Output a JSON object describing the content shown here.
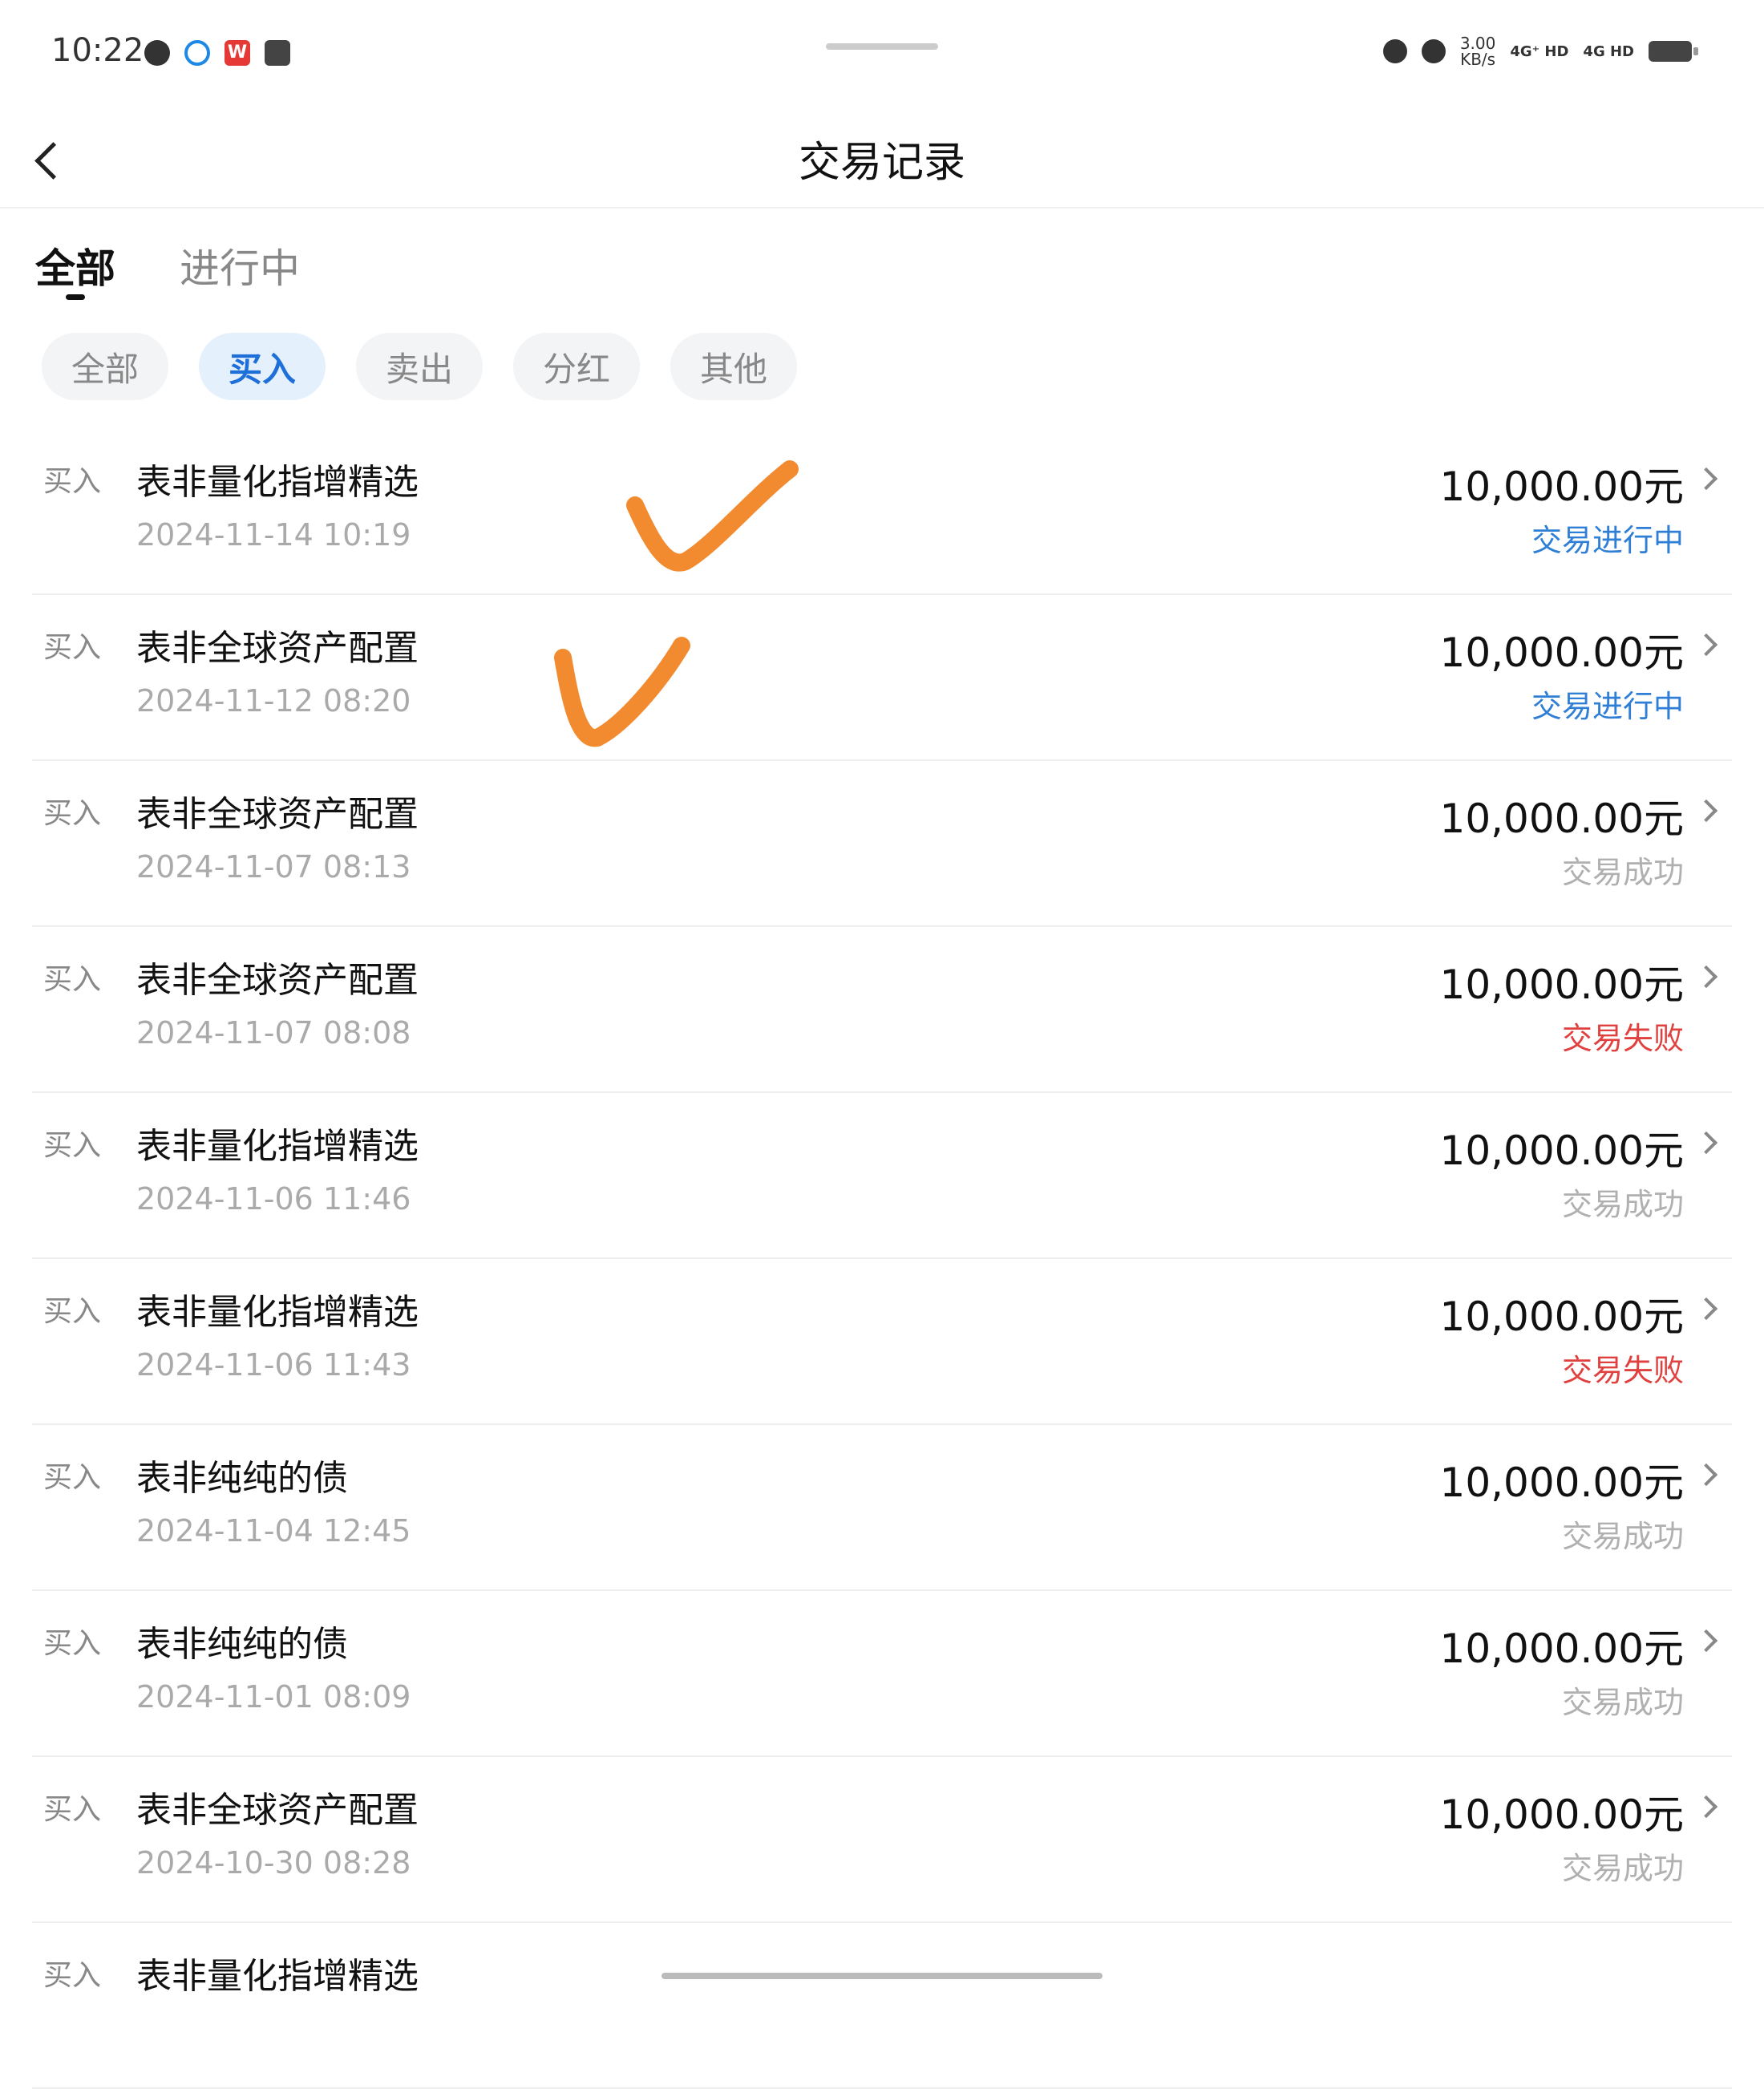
{
  "status_bar": {
    "time": "10:22",
    "speed_value": "3.00",
    "speed_unit": "KB/s",
    "net1": "4G⁺ HD",
    "net2": "4G HD"
  },
  "header": {
    "title": "交易记录"
  },
  "tabs": [
    {
      "label": "全部",
      "active": true
    },
    {
      "label": "进行中",
      "active": false
    }
  ],
  "filters": [
    {
      "label": "全部",
      "active": false
    },
    {
      "label": "买入",
      "active": true
    },
    {
      "label": "卖出",
      "active": false
    },
    {
      "label": "分红",
      "active": false
    },
    {
      "label": "其他",
      "active": false
    }
  ],
  "colors": {
    "pending": "#2f7fd6",
    "success": "#b0b0b0",
    "failed": "#e0413f",
    "checkmark": "#f28b30"
  },
  "records": [
    {
      "type": "买入",
      "name": "表非量化指增精选",
      "date": "2024-11-14 10:19",
      "amount": "10,000.00元",
      "status": "交易进行中"
    },
    {
      "type": "买入",
      "name": "表非全球资产配置",
      "date": "2024-11-12 08:20",
      "amount": "10,000.00元",
      "status": "交易进行中"
    },
    {
      "type": "买入",
      "name": "表非全球资产配置",
      "date": "2024-11-07 08:13",
      "amount": "10,000.00元",
      "status": "交易成功"
    },
    {
      "type": "买入",
      "name": "表非全球资产配置",
      "date": "2024-11-07 08:08",
      "amount": "10,000.00元",
      "status": "交易失败"
    },
    {
      "type": "买入",
      "name": "表非量化指增精选",
      "date": "2024-11-06 11:46",
      "amount": "10,000.00元",
      "status": "交易成功"
    },
    {
      "type": "买入",
      "name": "表非量化指增精选",
      "date": "2024-11-06 11:43",
      "amount": "10,000.00元",
      "status": "交易失败"
    },
    {
      "type": "买入",
      "name": "表非纯纯的债",
      "date": "2024-11-04 12:45",
      "amount": "10,000.00元",
      "status": "交易成功"
    },
    {
      "type": "买入",
      "name": "表非纯纯的债",
      "date": "2024-11-01 08:09",
      "amount": "10,000.00元",
      "status": "交易成功"
    },
    {
      "type": "买入",
      "name": "表非全球资产配置",
      "date": "2024-10-30 08:28",
      "amount": "10,000.00元",
      "status": "交易成功"
    },
    {
      "type": "买入",
      "name": "表非量化指增精选",
      "date": "",
      "amount": "",
      "status": ""
    }
  ]
}
